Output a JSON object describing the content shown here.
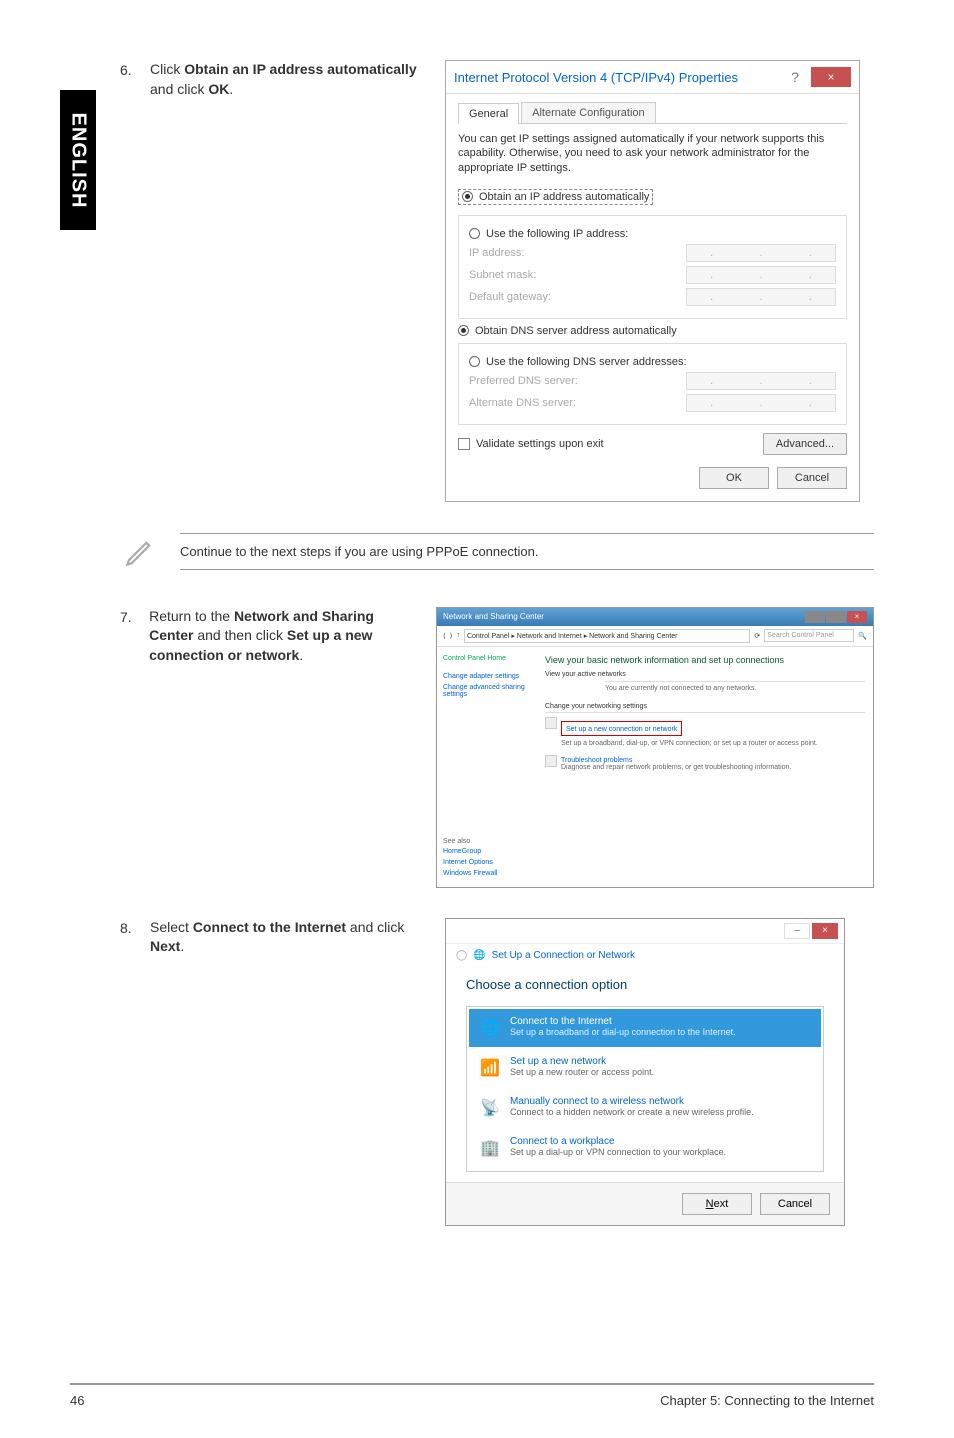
{
  "sidebar": {
    "language": "ENGLISH"
  },
  "step6": {
    "num": "6.",
    "text_prefix": "Click ",
    "bold1": "Obtain an IP address automatically",
    "text_mid": " and click ",
    "bold2": "OK",
    "text_suffix": "."
  },
  "dialog1": {
    "title": "Internet Protocol Version 4 (TCP/IPv4) Properties",
    "help": "?",
    "close": "×",
    "tab_general": "General",
    "tab_alt": "Alternate Configuration",
    "desc": "You can get IP settings assigned automatically if your network supports this capability. Otherwise, you need to ask your network administrator for the appropriate IP settings.",
    "radio_auto_ip": "Obtain an IP address automatically",
    "radio_use_ip": "Use the following IP address:",
    "ip_address": "IP address:",
    "subnet": "Subnet mask:",
    "gateway": "Default gateway:",
    "radio_auto_dns": "Obtain DNS server address automatically",
    "radio_use_dns": "Use the following DNS server addresses:",
    "pref_dns": "Preferred DNS server:",
    "alt_dns": "Alternate DNS server:",
    "validate": "Validate settings upon exit",
    "advanced": "Advanced...",
    "ok": "OK",
    "cancel": "Cancel"
  },
  "note": {
    "text": "Continue to the next steps if you are using PPPoE connection."
  },
  "step7": {
    "num": "7.",
    "text_prefix": "Return to the ",
    "bold1": "Network and Sharing Center",
    "text_mid": " and then click ",
    "bold2": "Set up a new connection or network",
    "text_suffix": "."
  },
  "shot2": {
    "window_title": "Network and Sharing Center",
    "bread": "Control Panel  ▸  Network and Internet  ▸  Network and Sharing Center",
    "search_placeholder": "Search Control Panel",
    "side_home": "Control Panel Home",
    "side_adapter": "Change adapter settings",
    "side_sharing": "Change advanced sharing settings",
    "side_seealso": "See also",
    "side_homegroup": "HomeGroup",
    "side_internet": "Internet Options",
    "side_firewall": "Windows Firewall",
    "main_h": "View your basic network information and set up connections",
    "active_label": "View your active networks",
    "active_none": "You are currently not connected to any networks.",
    "change_settings": "Change your networking settings",
    "setup_link": "Set up a new connection or network",
    "setup_desc": "Set up a broadband, dial-up, or VPN connection; or set up a router or access point.",
    "trouble_link": "Troubleshoot problems",
    "trouble_desc": "Diagnose and repair network problems, or get troubleshooting information."
  },
  "step8": {
    "num": "8.",
    "text_prefix": "Select ",
    "bold1": "Connect to the Internet",
    "text_mid": " and click ",
    "bold2": "Next",
    "text_suffix": "."
  },
  "shot3": {
    "close": "×",
    "header": "Set Up a Connection or Network",
    "h": "Choose a connection option",
    "opt1_title": "Connect to the Internet",
    "opt1_desc": "Set up a broadband or dial-up connection to the Internet.",
    "opt2_title": "Set up a new network",
    "opt2_desc": "Set up a new router or access point.",
    "opt3_title": "Manually connect to a wireless network",
    "opt3_desc": "Connect to a hidden network or create a new wireless profile.",
    "opt4_title": "Connect to a workplace",
    "opt4_desc": "Set up a dial-up or VPN connection to your workplace.",
    "next": "Next",
    "cancel": "Cancel"
  },
  "footer": {
    "page": "46",
    "chapter": "Chapter 5: Connecting to the Internet"
  }
}
